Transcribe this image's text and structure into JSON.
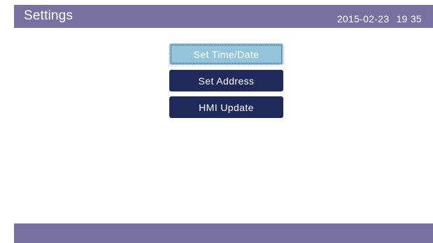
{
  "header": {
    "title": "Settings",
    "date": "2015-02-23",
    "time": "19 35"
  },
  "menu": {
    "items": [
      {
        "label": "Set Time/Date",
        "selected": true
      },
      {
        "label": "Set Address",
        "selected": false
      },
      {
        "label": "HMI Update",
        "selected": false
      }
    ]
  },
  "colors": {
    "bar": "#77719f",
    "button": "#1f2a5b",
    "button_selected": "#93c4d9",
    "background": "#ffffff"
  }
}
